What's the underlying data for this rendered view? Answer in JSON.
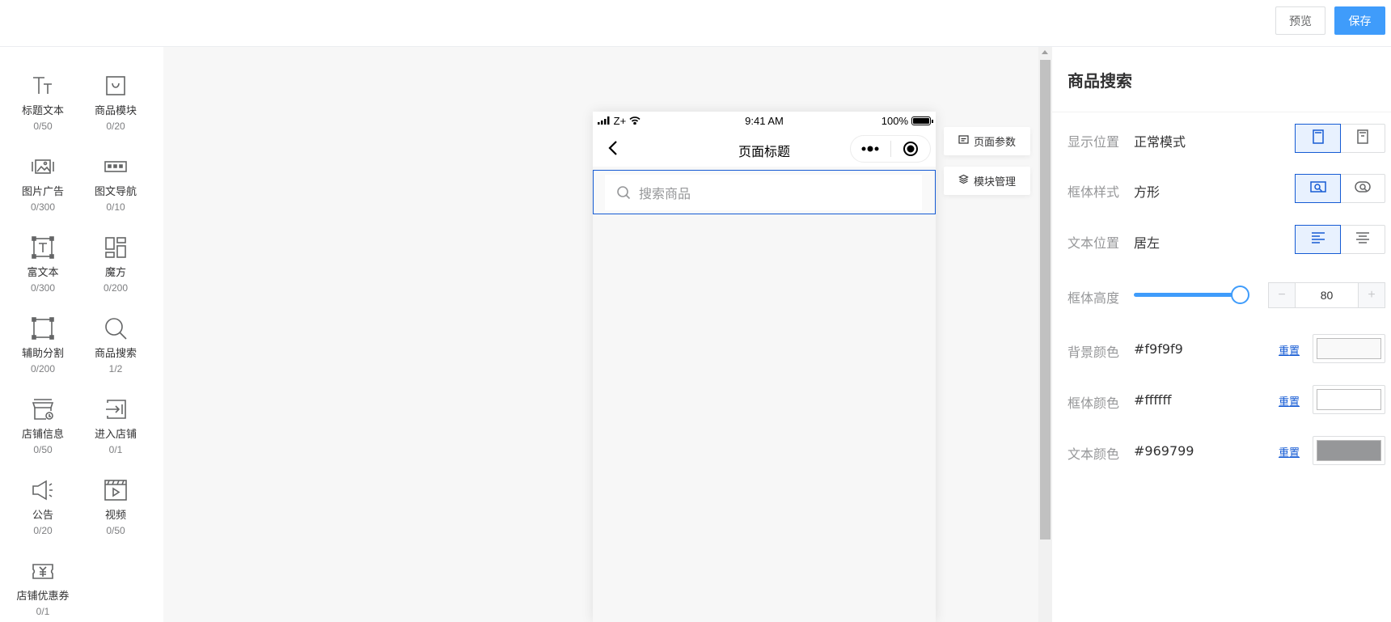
{
  "toolbar": {
    "preview_label": "预览",
    "save_label": "保存"
  },
  "components": [
    {
      "name": "标题文本",
      "count": "0/50",
      "icon": "title-text-icon"
    },
    {
      "name": "商品模块",
      "count": "0/20",
      "icon": "shopping-bag-icon"
    },
    {
      "name": "图片广告",
      "count": "0/300",
      "icon": "image-ad-icon"
    },
    {
      "name": "图文导航",
      "count": "0/10",
      "icon": "nav-dots-icon"
    },
    {
      "name": "富文本",
      "count": "0/300",
      "icon": "rich-text-icon"
    },
    {
      "name": "魔方",
      "count": "0/200",
      "icon": "cube-layout-icon"
    },
    {
      "name": "辅助分割",
      "count": "0/200",
      "icon": "divider-icon"
    },
    {
      "name": "商品搜索",
      "count": "1/2",
      "icon": "search-icon"
    },
    {
      "name": "店铺信息",
      "count": "0/50",
      "icon": "store-icon"
    },
    {
      "name": "进入店铺",
      "count": "0/1",
      "icon": "enter-store-icon"
    },
    {
      "name": "公告",
      "count": "0/20",
      "icon": "megaphone-icon"
    },
    {
      "name": "视频",
      "count": "0/50",
      "icon": "video-icon"
    },
    {
      "name": "店铺优惠券",
      "count": "0/1",
      "icon": "coupon-icon"
    }
  ],
  "phone": {
    "carrier": "Z+",
    "time": "9:41 AM",
    "battery": "100%",
    "page_title": "页面标题",
    "search_placeholder": "搜索商品"
  },
  "float_buttons": {
    "page_params": "页面参数",
    "module_manage": "模块管理"
  },
  "settings": {
    "title": "商品搜索",
    "display_position": {
      "label": "显示位置",
      "value": "正常模式"
    },
    "box_style": {
      "label": "框体样式",
      "value": "方形"
    },
    "text_position": {
      "label": "文本位置",
      "value": "居左"
    },
    "box_height": {
      "label": "框体高度",
      "value": "80",
      "minus": "−",
      "plus": "+"
    },
    "reset_label": "重置",
    "bg_color": {
      "label": "背景颜色",
      "value": "#f9f9f9"
    },
    "box_color": {
      "label": "框体颜色",
      "value": "#ffffff"
    },
    "text_color": {
      "label": "文本颜色",
      "value": "#969799"
    }
  },
  "colors": {
    "accent": "#3f9cfb",
    "active_border": "#155bd4"
  }
}
